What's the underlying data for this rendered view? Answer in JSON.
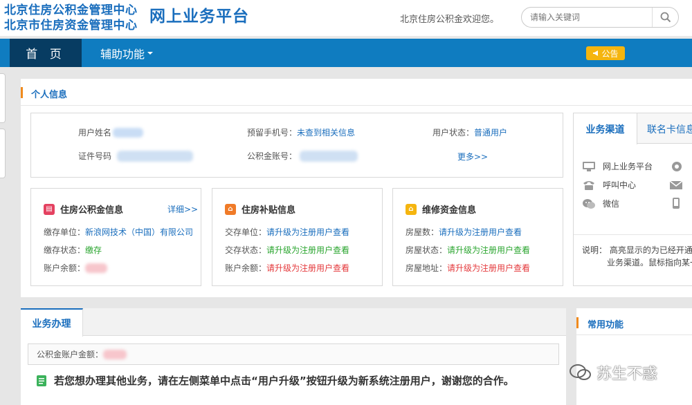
{
  "header": {
    "logo_line1": "北京住房公积金管理中心",
    "logo_line2": "北京市住房资金管理中心",
    "platform": "网上业务平台",
    "welcome": "北京住房公积金欢迎您。",
    "search_placeholder": "请输入关键词",
    "search_icon": "search-icon"
  },
  "nav": {
    "home": "首 页",
    "aux": "辅助功能",
    "notice": "公告"
  },
  "personal": {
    "title": "个人信息",
    "user_name_label": "用户姓名",
    "id_label": "证件号码",
    "phone_label": "预留手机号：",
    "phone_value": "未查到相关信息",
    "account_label": "公积金账号：",
    "status_label": "用户状态：",
    "status_value": "普通用户",
    "more": "更多>>"
  },
  "cards": {
    "fund": {
      "title": "住房公积金信息",
      "detail": "详细>>",
      "rows": [
        {
          "label": "缴存单位：",
          "value": "新浪网技术（中国）有限公司"
        },
        {
          "label": "缴存状态：",
          "value": "缴存"
        },
        {
          "label": "账户余额：",
          "value": ""
        }
      ]
    },
    "subsidy": {
      "title": "住房补贴信息",
      "rows": [
        {
          "label": "交存单位：",
          "value": "请升级为注册用户查看"
        },
        {
          "label": "交存状态：",
          "value": "请升级为注册用户查看"
        },
        {
          "label": "账户余额：",
          "value": "请升级为注册用户查看"
        }
      ]
    },
    "repair": {
      "title": "维修资金信息",
      "rows": [
        {
          "label": "房屋数：",
          "value": "请升级为注册用户查看"
        },
        {
          "label": "房屋状态：",
          "value": "请升级为注册用户查看"
        },
        {
          "label": "房屋地址：",
          "value": "请升级为注册用户查看"
        }
      ]
    }
  },
  "channels": {
    "tab_active": "业务渠道",
    "tab_other": "联名卡信息",
    "items": [
      "网上业务平台",
      "呼叫中心",
      "微信"
    ],
    "note_line1": "说明：  高亮显示的为已经开通的",
    "note_line2": "业务渠道。鼠标指向某一"
  },
  "business": {
    "tab": "业务办理",
    "balance_label": "公积金账户金额：",
    "message": "若您想办理其他业务，请在左侧菜单中点击“用户升级”按钮升级为新系统注册用户，谢谢您的合作。"
  },
  "common": {
    "title": "常用功能"
  },
  "watermark": "苏生不惑",
  "colors": {
    "brand_blue": "#1a6ebd",
    "nav_blue": "#0f7cc0",
    "nav_dark": "#073c62",
    "notice_orange": "#f5b50f",
    "accent_orange": "#f08a1c",
    "green": "#2aa52f",
    "red": "#e4393c"
  }
}
